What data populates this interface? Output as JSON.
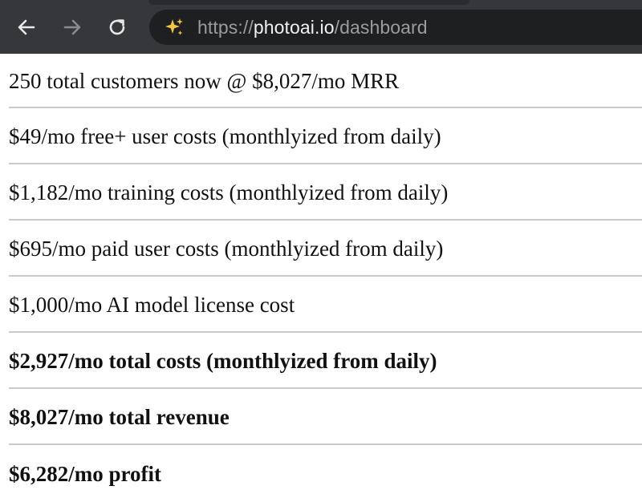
{
  "browser": {
    "url_scheme": "https://",
    "url_host": "photoai.io",
    "url_path": "/dashboard",
    "icons": {
      "back": "arrow-left-icon",
      "forward": "arrow-right-icon",
      "reload": "reload-icon",
      "site": "sparkles-icon"
    },
    "colors": {
      "toolbar": "#36373a",
      "omnibox": "#1e1f21",
      "sparkle": "#f5c542"
    }
  },
  "dashboard": {
    "rows": [
      {
        "text": "250 total customers now @ $8,027/mo MRR",
        "bold": false
      },
      {
        "text": "$49/mo free+ user costs (monthlyized from daily)",
        "bold": false
      },
      {
        "text": "$1,182/mo training costs (monthlyized from daily)",
        "bold": false
      },
      {
        "text": "$695/mo paid user costs (monthlyized from daily)",
        "bold": false
      },
      {
        "text": "$1,000/mo AI model license cost",
        "bold": false
      },
      {
        "text": "$2,927/mo total costs (monthlyized from daily)",
        "bold": true
      },
      {
        "text": "$8,027/mo total revenue",
        "bold": true
      },
      {
        "text": "$6,282/mo profit",
        "bold": true
      }
    ]
  }
}
